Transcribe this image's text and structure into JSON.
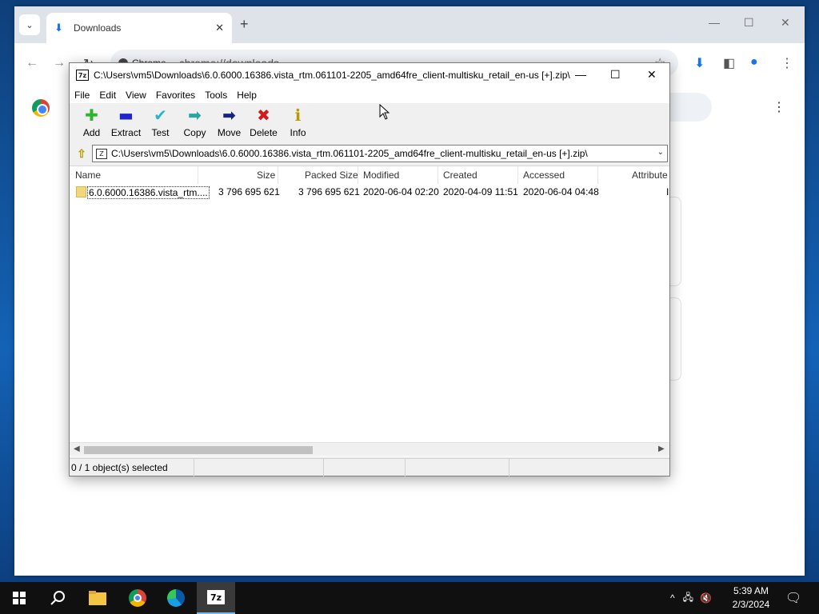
{
  "browser": {
    "tab_title": "Downloads",
    "chip_label": "Chrome",
    "url": "chrome://downloads"
  },
  "sevenzip": {
    "title": "C:\\Users\\vm5\\Downloads\\6.0.6000.16386.vista_rtm.061101-2205_amd64fre_client-multisku_retail_en-us [+].zip\\",
    "app_icon": "7z",
    "menu": [
      "File",
      "Edit",
      "View",
      "Favorites",
      "Tools",
      "Help"
    ],
    "toolbar": [
      {
        "label": "Add",
        "icon": "add-icon",
        "glyph": "✚",
        "color": "#2db52d"
      },
      {
        "label": "Extract",
        "icon": "extract-icon",
        "glyph": "▬",
        "color": "#1d27c9"
      },
      {
        "label": "Test",
        "icon": "test-icon",
        "glyph": "✔",
        "color": "#29b6c9"
      },
      {
        "label": "Copy",
        "icon": "copy-icon",
        "glyph": "➡",
        "color": "#2aa5a0"
      },
      {
        "label": "Move",
        "icon": "move-icon",
        "glyph": "➡",
        "color": "#1a237e"
      },
      {
        "label": "Delete",
        "icon": "delete-icon",
        "glyph": "✖",
        "color": "#d11a1a"
      },
      {
        "label": "Info",
        "icon": "info-icon",
        "glyph": "ℹ",
        "color": "#b59a00"
      }
    ],
    "address": "C:\\Users\\vm5\\Downloads\\6.0.6000.16386.vista_rtm.061101-2205_amd64fre_client-multisku_retail_en-us [+].zip\\",
    "columns": [
      "Name",
      "Size",
      "Packed Size",
      "Modified",
      "Created",
      "Accessed",
      "Attribute"
    ],
    "rows": [
      {
        "name": "6.0.6000.16386.vista_rtm....",
        "size": "3 796 695 621",
        "packed_size": "3 796 695 621",
        "modified": "2020-06-04 02:20",
        "created": "2020-04-09 11:51",
        "accessed": "2020-06-04 04:48",
        "attribute": "I"
      }
    ],
    "status": "0 / 1 object(s) selected"
  },
  "taskbar": {
    "time": "5:39 AM",
    "date": "2/3/2024",
    "apps": [
      "start-button",
      "search-button",
      "file-explorer",
      "chrome",
      "edge",
      "7zip"
    ]
  }
}
